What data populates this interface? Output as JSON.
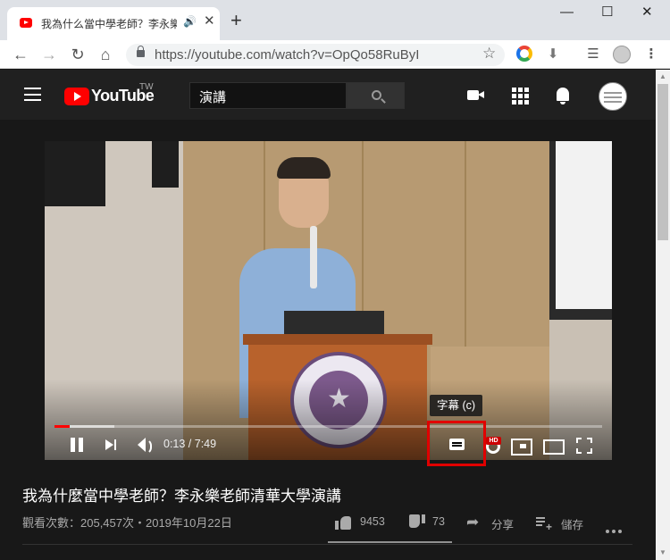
{
  "browser": {
    "tab_title": "我為什么當中學老師？李永樂",
    "tab_audio": "🔊",
    "tab_close": "✕",
    "new_tab": "+",
    "win_min": "—",
    "win_max": "☐",
    "win_close": "✕",
    "url": "https://youtube.com/watch?v=OpQo58RuByI",
    "back": "←",
    "forward": "→",
    "reload": "↻",
    "home": "⌂",
    "star": "☆",
    "ext_download": "⬇",
    "ext_queue": "☰",
    "menu": "⋮"
  },
  "youtube": {
    "logo_text": "YouTube",
    "region": "TW",
    "search_query": "演講"
  },
  "player": {
    "current_time": "0:13",
    "duration": "7:49",
    "time_display": "0:13 / 7:49",
    "played_fraction": 0.028,
    "loaded_fraction": 0.11,
    "tooltip": "字幕 (c)",
    "hd_label": "HD"
  },
  "video": {
    "title": "我為什麼當中學老師？李永樂老師清華大學演講",
    "view_info": "觀看次數：205,457次・2019年10月22日",
    "likes": "9453",
    "dislikes": "73",
    "share_label": "分享",
    "save_label": "儲存",
    "like_ratio": 0.992
  },
  "colors": {
    "accent": "#ff0000",
    "highlight_box": "#e00000",
    "background": "#181818"
  }
}
